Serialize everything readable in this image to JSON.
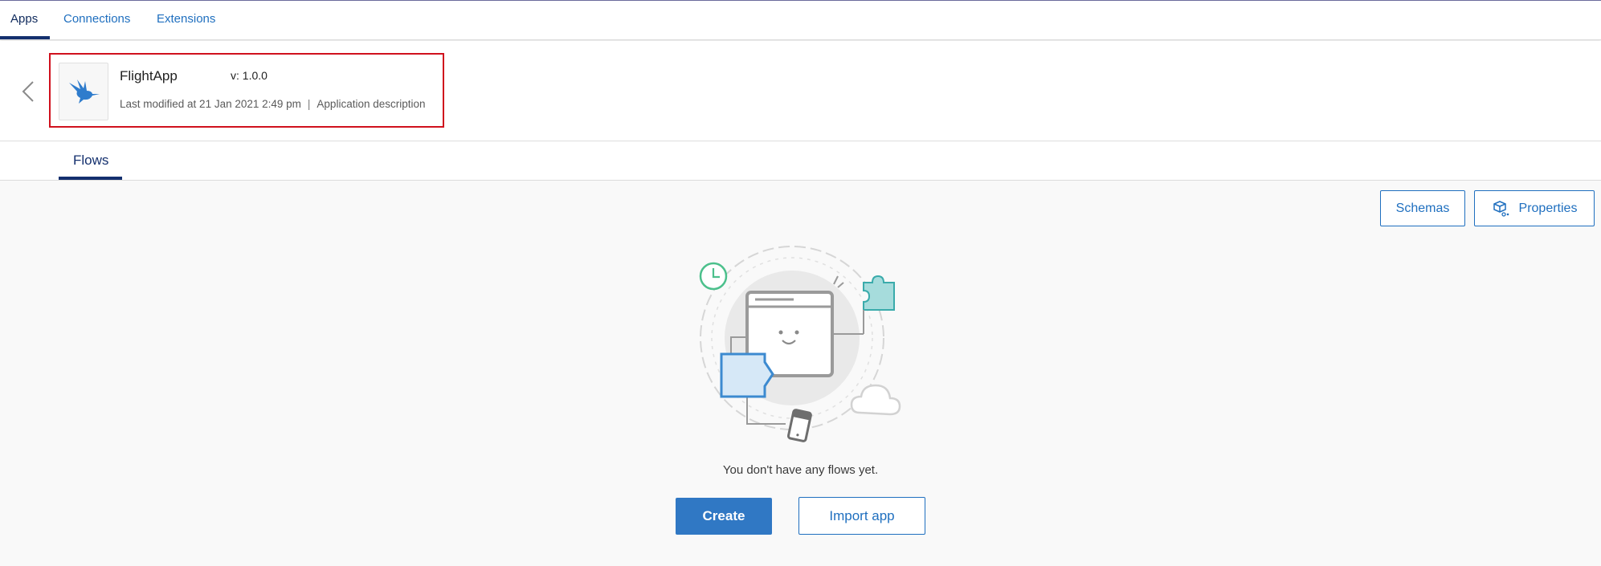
{
  "nav": {
    "tabs": [
      {
        "label": "Apps",
        "active": true
      },
      {
        "label": "Connections",
        "active": false
      },
      {
        "label": "Extensions",
        "active": false
      }
    ]
  },
  "app": {
    "name": "FlightApp",
    "version": "v: 1.0.0",
    "modified": "Last modified at 21 Jan 2021 2:49 pm",
    "separator": "|",
    "description": "Application description",
    "icon": "hummingbird-logo"
  },
  "subtabs": [
    {
      "label": "Flows",
      "active": true
    }
  ],
  "toolbar": {
    "schemas_label": "Schemas",
    "properties_label": "Properties"
  },
  "empty_state": {
    "message": "You don't have any flows yet.",
    "create_label": "Create",
    "import_label": "Import app"
  },
  "colors": {
    "accent": "#1f6fbf",
    "primary_button": "#3078c4",
    "nav_active": "#14306e",
    "highlight_border": "#d0111d"
  }
}
